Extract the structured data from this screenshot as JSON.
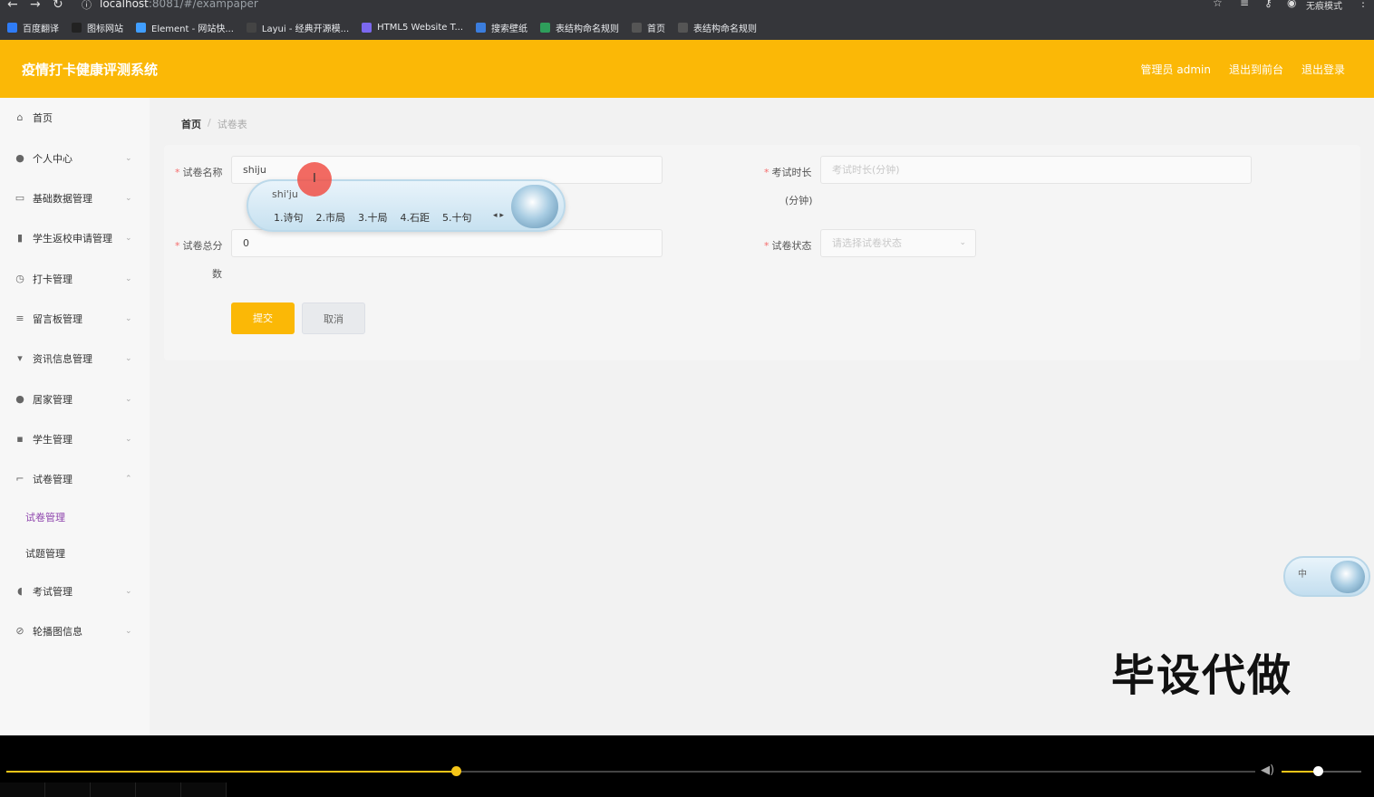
{
  "browser": {
    "url_host": "localhost",
    "url_path": ":8081/#/exampaper",
    "profile_label": "无痕模式",
    "bookmarks": [
      {
        "label": "百度翻译",
        "color": "#2f7cf6"
      },
      {
        "label": "图标网站",
        "color": "#222222"
      },
      {
        "label": "Element - 网站快...",
        "color": "#409eff"
      },
      {
        "label": "Layui - 经典开源模...",
        "color": "#444444"
      },
      {
        "label": "HTML5 Website T...",
        "color": "#7b68ee"
      },
      {
        "label": "搜索壁纸",
        "color": "#3b7ddd"
      },
      {
        "label": "表结构命名规则",
        "color": "#2e9e5b"
      },
      {
        "label": "首页",
        "color": "#555555"
      },
      {
        "label": "表结构命名规则",
        "color": "#555555"
      }
    ]
  },
  "header": {
    "title": "疫情打卡健康评测系统",
    "links": [
      "管理员 admin",
      "退出到前台",
      "退出登录"
    ],
    "bg_color": "#fbb806"
  },
  "sidebar": {
    "items": [
      {
        "label": "首页",
        "icon": "home-icon",
        "glyph": "⌂",
        "has_children": false
      },
      {
        "label": "个人中心",
        "icon": "user-icon",
        "glyph": "●",
        "has_children": true
      },
      {
        "label": "基础数据管理",
        "icon": "card-icon",
        "glyph": "▭",
        "has_children": true
      },
      {
        "label": "学生返校申请管理",
        "icon": "bar-chart-icon",
        "glyph": "▮",
        "has_children": true
      },
      {
        "label": "打卡管理",
        "icon": "clock-icon",
        "glyph": "◷",
        "has_children": true
      },
      {
        "label": "留言板管理",
        "icon": "sliders-icon",
        "glyph": "≡",
        "has_children": true
      },
      {
        "label": "资讯信息管理",
        "icon": "pin-icon",
        "glyph": "▾",
        "has_children": true
      },
      {
        "label": "居家管理",
        "icon": "user-icon",
        "glyph": "●",
        "has_children": true
      },
      {
        "label": "学生管理",
        "icon": "thumb-icon",
        "glyph": "▪",
        "has_children": true
      },
      {
        "label": "试卷管理",
        "icon": "crop-icon",
        "glyph": "⌐",
        "has_children": true,
        "expanded": true
      },
      {
        "label": "考试管理",
        "icon": "mic-icon",
        "glyph": "◖",
        "has_children": true
      },
      {
        "label": "轮播图信息",
        "icon": "no-image-icon",
        "glyph": "⊘",
        "has_children": true
      }
    ],
    "submenu": [
      {
        "label": "试卷管理",
        "active": true
      },
      {
        "label": "试题管理",
        "active": false
      }
    ]
  },
  "breadcrumb": {
    "home": "首页",
    "separator": "/",
    "current": "试卷表"
  },
  "form": {
    "paper_name_label": "试卷名称",
    "paper_name_value": "shiju",
    "exam_duration_label": "考试时长",
    "exam_duration_label_unit": "(分钟)",
    "exam_duration_placeholder": "考试时长(分钟)",
    "total_score_label": "试卷总分",
    "total_score_label_tail": "数",
    "total_score_value": "0",
    "status_label": "试卷状态",
    "status_placeholder": "请选择试卷状态",
    "submit_label": "提交",
    "cancel_label": "取消"
  },
  "ime": {
    "pinyin": "shi'ju",
    "candidates": [
      "1.诗句",
      "2.市局",
      "3.十局",
      "4.石距",
      "5.十句"
    ],
    "mini_label": "中"
  },
  "watermark": "毕设代做",
  "video": {
    "progress": 0.36,
    "volume": 0.45
  }
}
